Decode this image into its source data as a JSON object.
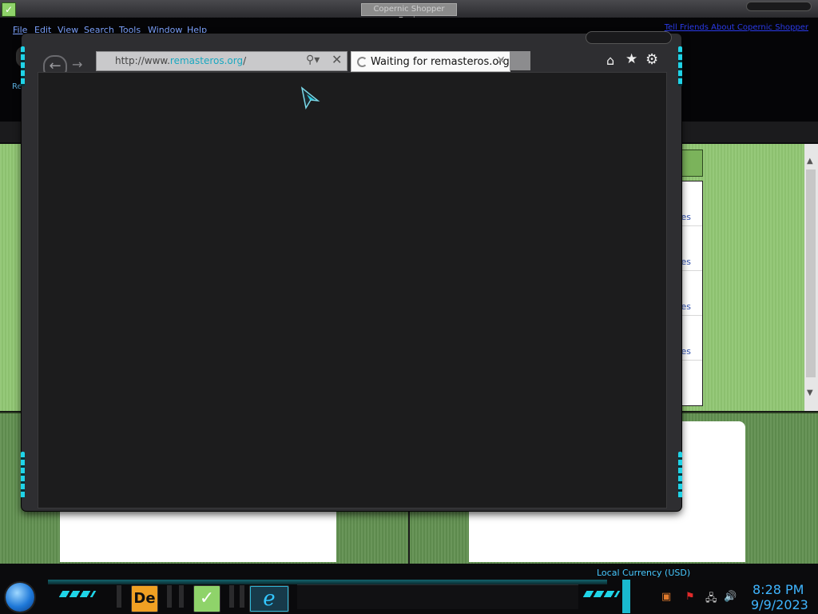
{
  "app": {
    "title": "Copernic Shopper Basic",
    "menu": [
      "File",
      "Edit",
      "View",
      "Search",
      "Tools",
      "Window",
      "Help"
    ],
    "menu_link": "Tell Friends About Copernic Shopper",
    "toolbar_label": "Re",
    "list_links": [
      "ces",
      "ces",
      "ces",
      "ces"
    ]
  },
  "browser": {
    "address_prefix": "http://www.",
    "address_domain": "remasteros.org",
    "address_suffix": "/",
    "tab_title": "Waiting for remasteros.org",
    "icons": {
      "back": "back-arrow-icon",
      "forward": "forward-arrow-icon",
      "search": "search-icon",
      "stop": "close-icon",
      "home": "home-icon",
      "favorites": "star-icon",
      "tools": "gear-icon"
    },
    "accent": "#1fd4e8"
  },
  "taskbar": {
    "apps": [
      "De",
      "shopper",
      "ie"
    ],
    "currency": "Local Currency (USD)",
    "time": "8:28 PM",
    "date": "9/9/2023"
  }
}
